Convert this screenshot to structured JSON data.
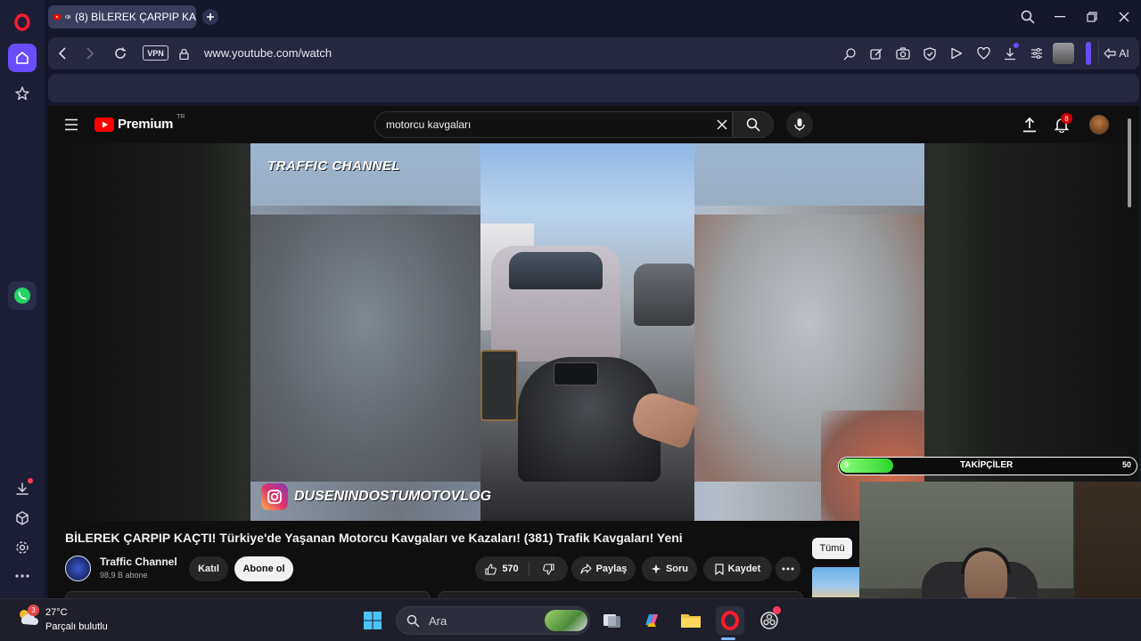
{
  "browser": {
    "tab_title": "(8) BİLEREK ÇARPIP KA",
    "url": "www.youtube.com/watch",
    "vpn_label": "VPN",
    "ai_label": "AI"
  },
  "youtube": {
    "logo_text": "Premium",
    "region": "TR",
    "search_value": "motorcu kavgaları",
    "notification_count": "8",
    "video_watermark": "TRAFFIC CHANNEL",
    "instagram_handle": "DUSENINDOSTUMOTOVLOG",
    "video_title": "BİLEREK ÇARPIP KAÇTI! Türkiye'de Yaşanan Motorcu Kavgaları ve Kazaları! (381) Trafik Kavgaları! Yeni",
    "channel_name": "Traffic Channel",
    "channel_subs": "98,9 B abone",
    "join_label": "Katıl",
    "subscribe_label": "Abone ol",
    "like_count": "570",
    "share_label": "Paylaş",
    "ask_label": "Soru",
    "save_label": "Kaydet",
    "filter_all_label": "Tümü"
  },
  "overlay": {
    "follower_label": "TAKİPÇİLER",
    "follower_current": "9",
    "follower_goal": "50",
    "follower_progress": 0.18
  },
  "taskbar": {
    "weather_temp": "27°C",
    "weather_desc": "Parçalı bulutlu",
    "weather_badge": "3",
    "search_placeholder": "Ara"
  },
  "colors": {
    "opera_red": "#ff1b2d",
    "opera_accent": "#6a4cff",
    "youtube_red": "#ff0000",
    "follower_green": "#2ed42e"
  }
}
